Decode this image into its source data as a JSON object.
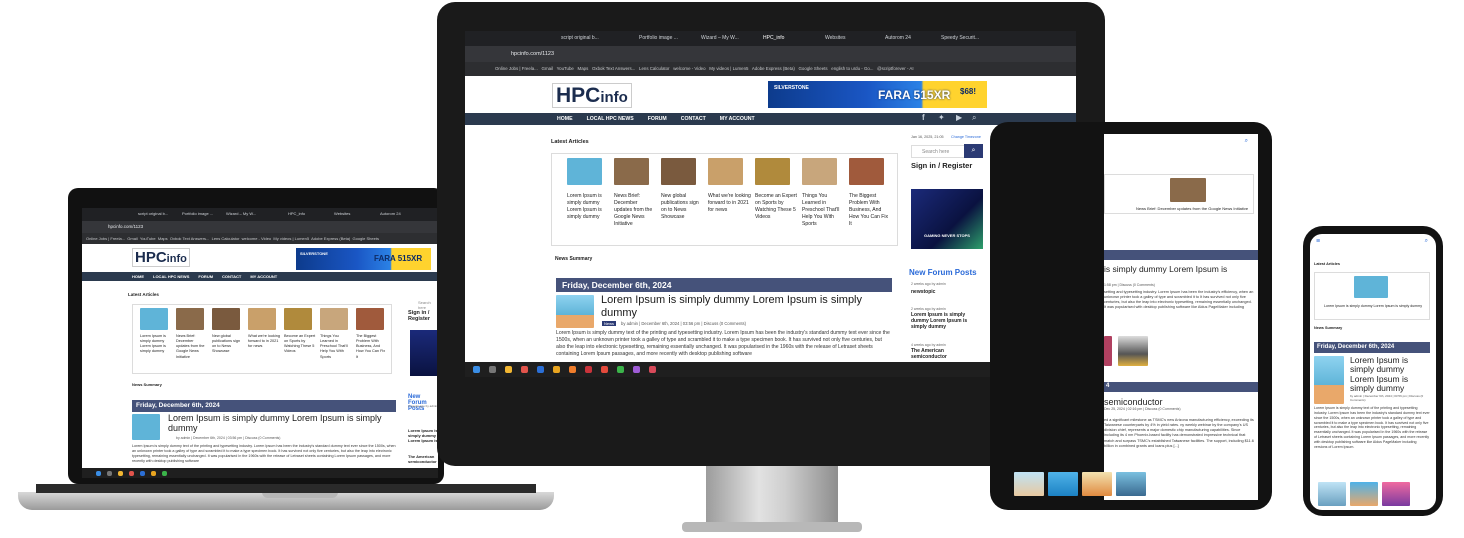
{
  "site": {
    "logo_main": "HPC",
    "logo_sub": "info",
    "banner_brand": "SILVERSTONE",
    "banner_tagline": "FARA 515XR",
    "banner_price": "$68!",
    "url": "hpcinfo.com/1123",
    "nav": [
      "HOME",
      "LOCAL HPC NEWS",
      "FORUM",
      "CONTACT",
      "MY ACCOUNT"
    ],
    "section_latest": "Latest Articles",
    "section_news_summary": "News Summary",
    "date_bar": "Friday, December 6th, 2024",
    "post_title": "Lorem Ipsum is simply dummy Lorem Ipsum is simply dummy",
    "post_meta_tag": "News",
    "post_meta": "by admin | December 6th, 2024 | 03:56 pm | Discuss (0 Comments)",
    "post_body": "Lorem Ipsum is simply dummy text of the printing and typesetting industry. Lorem Ipsum has been the industry's standard dummy text ever since the 1500s, when an unknown printer took a galley of type and scrambled it to make a type specimen book. It has survived not only five centuries, but also the leap into electronic typesetting, remaining essentially unchanged. It was popularised in the 1960s with the release of Letraset sheets containing Lorem Ipsum passages, and more recently with desktop publishing software",
    "articles": [
      {
        "title": "Lorem Ipsum is simply dummy Lorem Ipsum is simply dummy",
        "color": "#5fb4d8"
      },
      {
        "title": "News Brief: December updates from the Google News Initiative",
        "color": "#8a6a4a"
      },
      {
        "title": "New global publications sign on to News Showcase",
        "color": "#7a5a3e"
      },
      {
        "title": "What we're looking forward to in 2021 for news",
        "color": "#c9a06a"
      },
      {
        "title": "Become an Expert on Sports by Watching These 5 Videos",
        "color": "#b08a3c"
      },
      {
        "title": "Things You Learned in Preschool That'll Help You With Sports",
        "color": "#c8a67c"
      },
      {
        "title": "The Biggest Problem With Business, And How You Can Fix It",
        "color": "#a05a3c"
      }
    ],
    "sidebar": {
      "date": "Jan 16, 2025, 21:05",
      "timezone_link": "Change Timezone",
      "search_placeholder": "Search here",
      "signin": "Sign in / Register",
      "ad_text": "GAMING NEVER STOPS",
      "forum_heading": "New Forum Posts",
      "forum_posts": [
        {
          "meta": "2 weeks ago by admin",
          "title": "newstopic"
        },
        {
          "meta": "2 weeks ago by admin",
          "title": "Lorem Ipsum is simply dummy Lorem Ipsum is simply dummy"
        },
        {
          "meta": "4 weeks ago by admin",
          "title": "The American semiconductor"
        }
      ]
    }
  },
  "chrome": {
    "tabs": [
      "script original b...",
      "Portfolio image ...",
      "Wizard – My W...",
      "HPC_info",
      "Websites",
      "Autorom 24",
      "Speedy Securit..."
    ],
    "bookmarks": [
      "Online Jobs | Freela...",
      "Gmail",
      "YouTube",
      "Maps",
      "Oxbok Text Answers...",
      "Lens Calculator",
      "welcome - Video",
      "My videos | Lumen5",
      "Adobe Express (Beta)",
      "Google Sheets",
      "english to urdu - Go...",
      "@scriptforever - AI"
    ]
  },
  "taskbar": {
    "time": "9:05 PM",
    "date": "1/16/2025"
  },
  "tablet": {
    "news_brief": "News Brief: December updates from the Google News Initiative",
    "title_partial": "is simply dummy Lorem Ipsum is",
    "date_bar_partial": "4",
    "semiconductor_title": "semiconductor",
    "semiconductor_meta": "Dec 25, 2024 | 02:16 pm | Discuss (0 Comments)",
    "semi_body": "ed a significant milestone as TSMC's new Arizona manufacturing efficiency, exceeding its Taiwanese counterparts by 4% in yield rates. ny weekly webinar by the company's US division chief, represents a major domestic chip manufacturing capabilities. Since including its 4 nm Phoenix-based facility has demonstrated impressive technical that match and surpass TSMC's established Taiwanese facilities. The support, including $11.6 billion in combined grants and loans plus [...]",
    "intro_body": "setting and typesetting industry. Lorem Ipsum has been the industry's efficiency, when an unknown printer took a galley of type and scrambled it to It has survived not only five centuries, but also the leap into electronic typesetting, remaining essentially unchanged. It was popularised with desktop publishing software like Aldus PageMaker including",
    "meta": "1:58 pm | Discuss (0 Comments)"
  },
  "phone": {
    "latest": "Latest Articles",
    "article_title": "Lorem Ipsum is simply dummy Lorem Ipsum is simply dummy",
    "news_summary": "News Summary",
    "date_bar": "Friday, December 6th, 2024",
    "post_title": "Lorem Ipsum is simply dummy Lorem Ipsum is simply dummy",
    "meta": "by admin | December 6th, 2024 | 03:56 pm | Discuss (0 Comments)",
    "body": "Lorem Ipsum is simply dummy text of the printing and typesetting industry. Lorem Ipsum has been the industry's standard dummy text ever since the 1500s, when an unknown printer took a galley of type and scrambled it to make a type specimen book. It has survived not only five centuries, but also the leap into electronic typesetting, remaining essentially unchanged. It was popularised in the 1960s with the release of Letraset sheets containing Lorem Ipsum passages, and more recently with desktop publishing software like Aldus PageMaker including versions of Lorem Ipsum."
  }
}
